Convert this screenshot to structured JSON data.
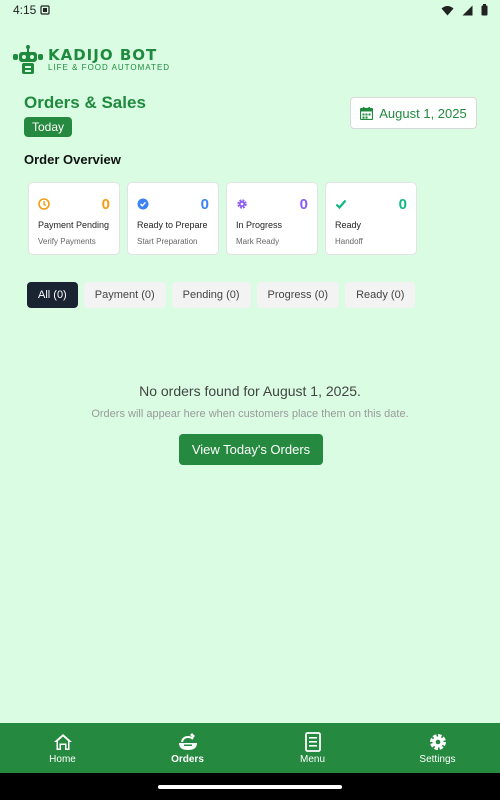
{
  "status_bar": {
    "time": "4:15"
  },
  "brand": {
    "name": "KADIJO BOT",
    "tagline": "LIFE & FOOD AUTOMATED",
    "color": "#1f8a3d"
  },
  "header": {
    "title": "Orders & Sales",
    "badge": "Today",
    "date": "August 1, 2025"
  },
  "overview": {
    "title": "Order Overview",
    "cards": [
      {
        "title": "Payment Pending",
        "count": "0",
        "subtitle": "Verify Payments",
        "icon": "clock-icon",
        "color": "#f39c12"
      },
      {
        "title": "Ready to Prepare",
        "count": "0",
        "subtitle": "Start Preparation",
        "icon": "check-circle-icon",
        "color": "#3b82f6"
      },
      {
        "title": "In Progress",
        "count": "0",
        "subtitle": "Mark Ready",
        "icon": "gear-icon",
        "color": "#8b5cf6"
      },
      {
        "title": "Ready",
        "count": "0",
        "subtitle": "Handoff",
        "icon": "check-icon",
        "color": "#10b981"
      }
    ]
  },
  "filters": [
    {
      "label": "All (0)",
      "active": true
    },
    {
      "label": "Payment (0)",
      "active": false
    },
    {
      "label": "Pending (0)",
      "active": false
    },
    {
      "label": "Progress (0)",
      "active": false
    },
    {
      "label": "Ready (0)",
      "active": false
    }
  ],
  "empty_state": {
    "title": "No orders found for August 1, 2025.",
    "subtitle": "Orders will appear here when customers place them on this date.",
    "button": "View Today's Orders"
  },
  "nav": [
    {
      "label": "Home",
      "icon": "home-icon",
      "active": false
    },
    {
      "label": "Orders",
      "icon": "food-bowl-icon",
      "active": true
    },
    {
      "label": "Menu",
      "icon": "document-icon",
      "active": false
    },
    {
      "label": "Settings",
      "icon": "gear-icon",
      "active": false
    }
  ]
}
